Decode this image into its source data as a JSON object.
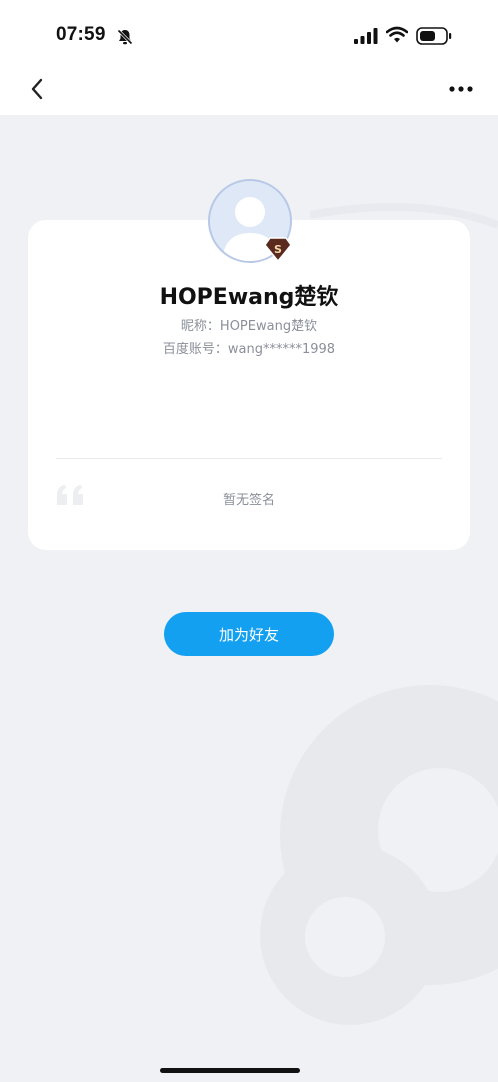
{
  "status_bar": {
    "time": "07:59",
    "icons": [
      "bell-slash-icon",
      "cellular-signal-icon",
      "wifi-icon",
      "battery-icon"
    ]
  },
  "nav": {
    "back_icon": "chevron-left-icon",
    "more_icon": "more-dots-icon"
  },
  "profile": {
    "display_name": "HOPEwang楚钦",
    "nickname": "昵称：HOPEwang楚钦",
    "account": "百度账号：wang******1998",
    "badge_letter": "S",
    "signature_placeholder": "暂无签名"
  },
  "actions": {
    "add_friend_label": "加为好友"
  },
  "colors": {
    "accent": "#14a0f0",
    "background": "#f0f1f4",
    "card": "#ffffff",
    "muted_text": "#8a8f99",
    "badge": "#5b2a1e"
  }
}
